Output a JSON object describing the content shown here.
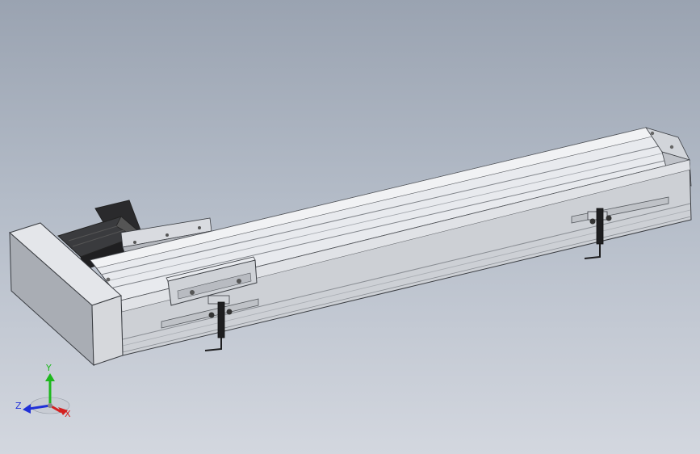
{
  "viewport": {
    "background_top": "#9aa3b1",
    "background_bottom": "#d3d7df"
  },
  "model": {
    "parts": [
      {
        "name": "motor-end-cap",
        "icon": "end-cap"
      },
      {
        "name": "servo-motor",
        "icon": "motor"
      },
      {
        "name": "linear-rail-body",
        "icon": "rail"
      },
      {
        "name": "slider-carriage",
        "icon": "carriage"
      },
      {
        "name": "sensor-bracket-left",
        "icon": "sensor"
      },
      {
        "name": "sensor-bracket-right",
        "icon": "sensor"
      },
      {
        "name": "far-end-cap",
        "icon": "end-cap"
      }
    ],
    "colors": {
      "rail_top": "#e6e8ec",
      "rail_front": "#c9ccd2",
      "cap_front": "#d8dade",
      "cap_side": "#a8acb3",
      "motor": "#2a2a2c",
      "edge": "#3a3d42"
    }
  },
  "triad": {
    "y_label": "Y",
    "z_label": "Z",
    "x_label": "X",
    "colors": {
      "x": "#d42020",
      "y": "#1eb81e",
      "z": "#2030d8"
    }
  }
}
